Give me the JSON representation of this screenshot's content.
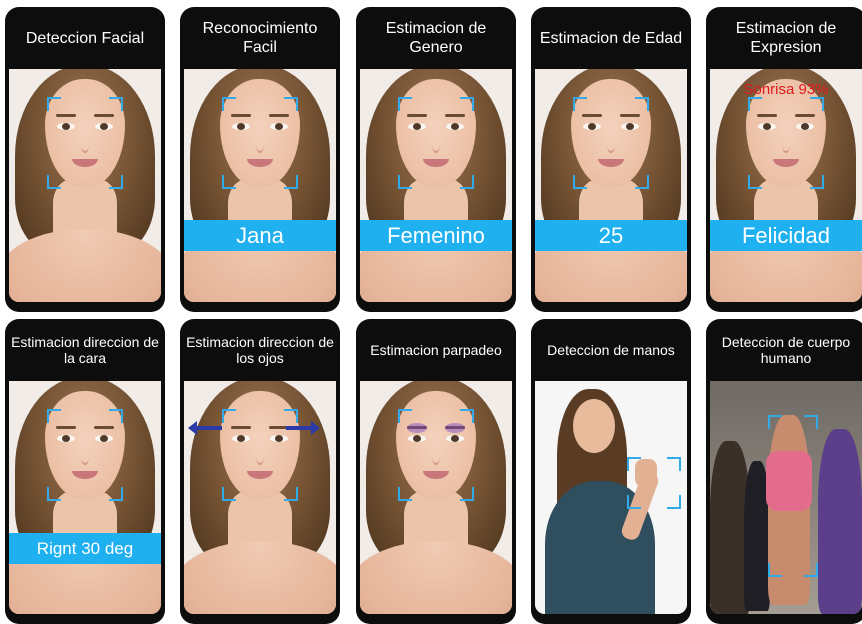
{
  "colors": {
    "frame": "#0d0d0d",
    "accent_blue": "#1fb0ef",
    "box_blue": "#33a9e8",
    "alert_red": "#e3181d",
    "arrow_blue": "#2a3aa8"
  },
  "panels": [
    {
      "title": "Deteccion Facial",
      "label": ""
    },
    {
      "title": "Reconocimiento Facil",
      "label": "Jana"
    },
    {
      "title": "Estimacion de Genero",
      "label": "Femenino"
    },
    {
      "title": "Estimacion de Edad",
      "label": "25"
    },
    {
      "title": "Estimacion de Expresion",
      "label": "Felicidad",
      "overlay": "Sonrisa 93%"
    },
    {
      "title": "Estimacion direccion de la cara",
      "label": "Rignt 30 deg"
    },
    {
      "title": "Estimacion direccion de los ojos",
      "label": ""
    },
    {
      "title": "Estimacion parpadeo",
      "label": ""
    },
    {
      "title": "Deteccion de manos",
      "label": ""
    },
    {
      "title": "Deteccion de cuerpo humano",
      "label": ""
    }
  ]
}
